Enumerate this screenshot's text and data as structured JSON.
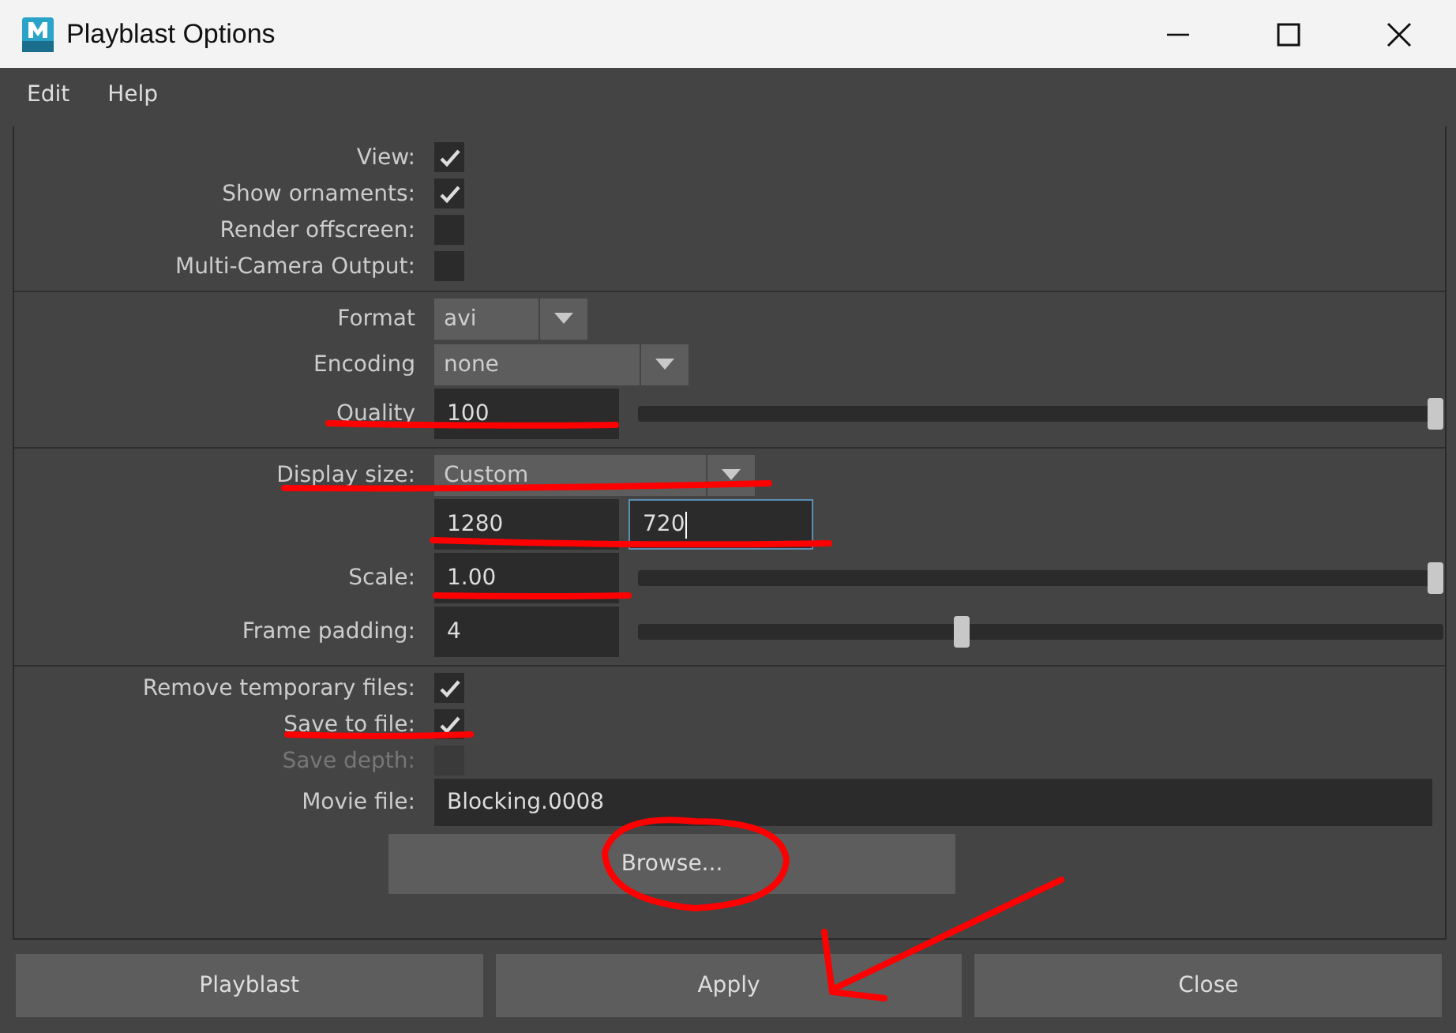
{
  "window": {
    "title": "Playblast Options"
  },
  "menu": [
    "Edit",
    "Help"
  ],
  "sections": [
    {
      "rows": [
        {
          "kind": "checkbox",
          "label": "View:",
          "checked": true,
          "disabled": false
        },
        {
          "kind": "checkbox",
          "label": "Show ornaments:",
          "checked": true,
          "disabled": false
        },
        {
          "kind": "checkbox",
          "label": "Render offscreen:",
          "checked": false,
          "disabled": false
        },
        {
          "kind": "checkbox",
          "label": "Multi-Camera Output:",
          "checked": false,
          "disabled": false
        }
      ]
    },
    {
      "rows": [
        {
          "kind": "dropdown",
          "label": "Format",
          "value": "avi"
        },
        {
          "kind": "dropdown",
          "label": "Encoding",
          "value": "none"
        },
        {
          "kind": "slider",
          "label": "Quality",
          "value": "100",
          "level": 1
        }
      ]
    },
    {
      "rows": [
        {
          "kind": "dropdown",
          "label": "Display size:",
          "value": "Custom"
        },
        {
          "kind": "pair",
          "fields": [
            {
              "value": "1280",
              "focused": false
            },
            {
              "value": "720",
              "focused": true
            }
          ]
        },
        {
          "kind": "slider",
          "label": "Scale:",
          "value": "1.00",
          "level": 1
        },
        {
          "kind": "slider",
          "label": "Frame padding:",
          "value": "4",
          "level": 0.4
        }
      ]
    },
    {
      "rows": [
        {
          "kind": "checkbox",
          "label": "Remove temporary files:",
          "checked": true,
          "disabled": false
        },
        {
          "kind": "checkbox",
          "label": "Save to file:",
          "checked": true,
          "disabled": false
        },
        {
          "kind": "checkbox",
          "label": "Save depth:",
          "checked": false,
          "disabled": true
        },
        {
          "kind": "file",
          "label": "Movie file:",
          "value": "Blocking.0008"
        },
        {
          "kind": "button",
          "label": "Browse..."
        }
      ]
    }
  ],
  "buttons": [
    "Playblast",
    "Apply",
    "Close"
  ]
}
